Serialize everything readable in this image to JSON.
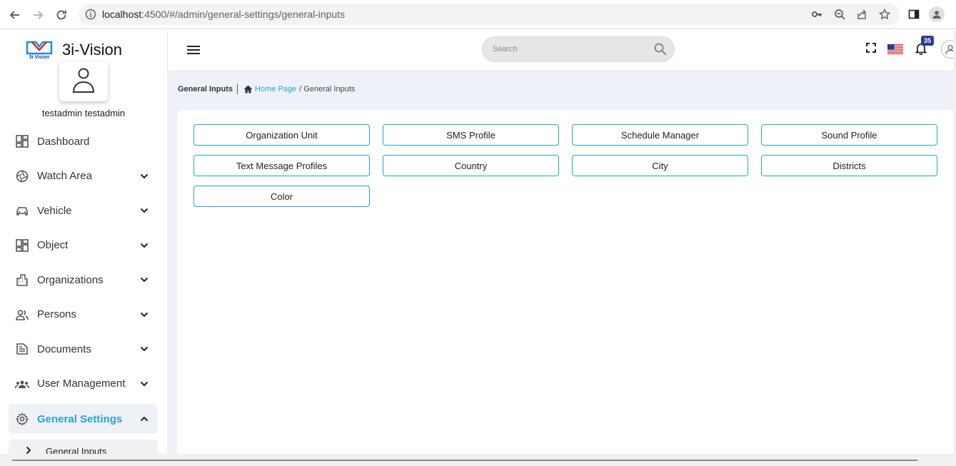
{
  "browser": {
    "url_host": "localhost",
    "url_rest": ":4500/#/admin/general-settings/general-inputs"
  },
  "app": {
    "name": "3i-Vision",
    "logo_text": "3i Vision"
  },
  "user": {
    "name": "testadmin testadmin"
  },
  "sidebar": {
    "items": [
      {
        "label": "Dashboard",
        "icon": "dashboard-icon",
        "chevron": ""
      },
      {
        "label": "Watch Area",
        "icon": "camera-shutter-icon",
        "chevron": "down"
      },
      {
        "label": "Vehicle",
        "icon": "car-icon",
        "chevron": "down"
      },
      {
        "label": "Object",
        "icon": "object-grid-icon",
        "chevron": "down"
      },
      {
        "label": "Organizations",
        "icon": "buildings-icon",
        "chevron": "down"
      },
      {
        "label": "Persons",
        "icon": "people-icon",
        "chevron": "down"
      },
      {
        "label": "Documents",
        "icon": "document-icon",
        "chevron": "down"
      },
      {
        "label": "User Management",
        "icon": "group-icon",
        "chevron": "down"
      },
      {
        "label": "General Settings",
        "icon": "gear-icon",
        "chevron": "up",
        "active": true
      }
    ],
    "submenu": {
      "label": "General Inputs"
    }
  },
  "header": {
    "search_placeholder": "Search",
    "notification_count": "35"
  },
  "breadcrumb": {
    "title": "General Inputs",
    "home": "Home Page",
    "current": "/ General Inputs"
  },
  "tiles": [
    "Organization Unit",
    "SMS Profile",
    "Schedule Manager",
    "Sound Profile",
    "Text Message Profiles",
    "Country",
    "City",
    "Districts",
    "Color"
  ],
  "colors": {
    "accent": "#29a3d3",
    "tile_border": "#22a9b8",
    "content_bg": "#eef2f8",
    "badge": "#2b3e8f"
  }
}
